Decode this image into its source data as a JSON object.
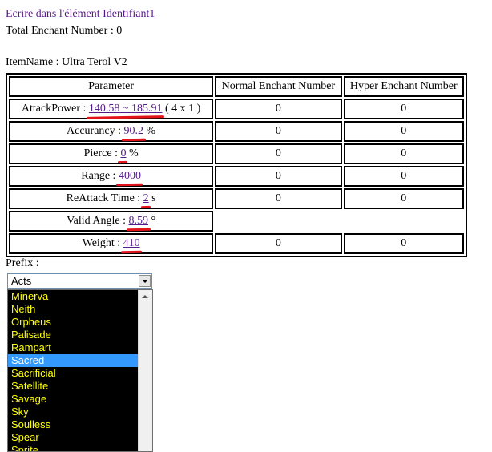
{
  "link_text": "Ecrire dans l'élément Identifiant1",
  "total_enchant": "Total Enchant Number : 0",
  "item_name": "ItemName : Ultra Terol V2",
  "headers": {
    "parameter": "Parameter",
    "normal": "Normal Enchant Number",
    "hyper": "Hyper Enchant Number"
  },
  "rows": [
    {
      "label": "AttackPower : ",
      "value": "140.58 ~ 185.91",
      "suffix": " ( 4 x 1 )",
      "normal": "0",
      "hyper": "0"
    },
    {
      "label": "Accurancy : ",
      "value": "90.2",
      "suffix": " %",
      "normal": "0",
      "hyper": "0"
    },
    {
      "label": "Pierce : ",
      "value": "0",
      "suffix": " %",
      "normal": "0",
      "hyper": "0"
    },
    {
      "label": "Range : ",
      "value": "4000",
      "suffix": "",
      "normal": "0",
      "hyper": "0"
    },
    {
      "label": "ReAttack Time : ",
      "value": "2",
      "suffix": " s",
      "normal": "0",
      "hyper": "0"
    },
    {
      "label": "Valid Angle : ",
      "value": "8.59",
      "suffix": " °"
    },
    {
      "label": "Weight : ",
      "value": "410",
      "suffix": "",
      "normal": "0",
      "hyper": "0"
    }
  ],
  "prefix_label": "Prefix :",
  "prefix_selected": "Acts",
  "prefix_options": [
    "Minerva",
    "Neith",
    "Orpheus",
    "Palisade",
    "Rampart",
    "Sacred",
    "Sacrificial",
    "Satellite",
    "Savage",
    "Sky",
    "Soulless",
    "Spear",
    "Sprite"
  ],
  "prefix_highlighted": "Sacred",
  "colors": {
    "link": "#551a8b",
    "option_text": "#ffff00",
    "option_bg": "#000000",
    "highlight": "#3399ff",
    "annotation": "#e2131b"
  }
}
